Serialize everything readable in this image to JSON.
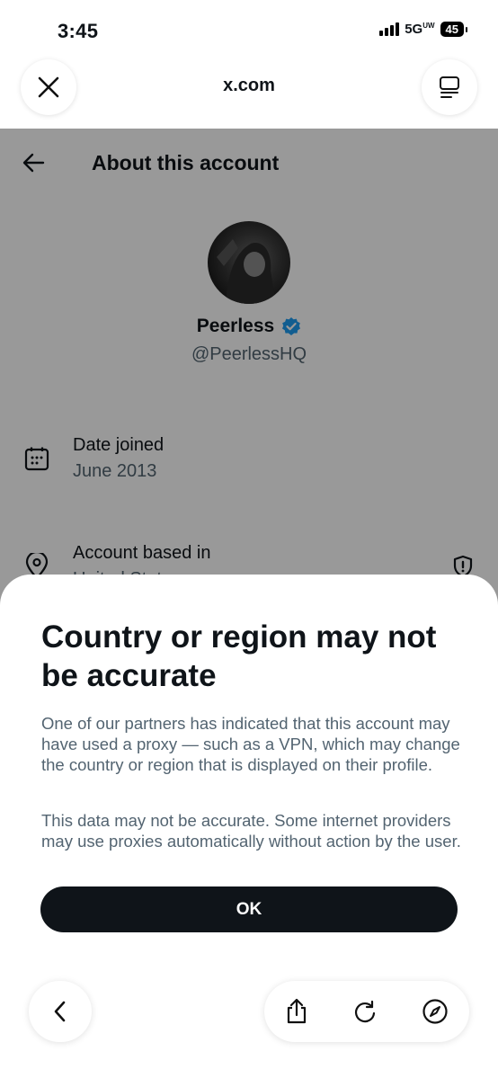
{
  "status_bar": {
    "time": "3:45",
    "network": "5G",
    "network_suffix": "UW",
    "battery": "45"
  },
  "browser": {
    "url": "x.com",
    "close_icon": "close-icon",
    "tabs_icon": "tabs-icon"
  },
  "page": {
    "header_title": "About this account",
    "profile": {
      "name": "Peerless",
      "handle": "@PeerlessHQ",
      "verified": true
    },
    "rows": [
      {
        "label": "Date joined",
        "value": "June 2013",
        "icon": "calendar-icon"
      },
      {
        "label": "Account based in",
        "value": "United States",
        "icon": "location-pin-icon"
      }
    ]
  },
  "sheet": {
    "title": "Country or region may not be accurate",
    "paragraph_1": "One of our partners has indicated that this account may have used a proxy — such as a VPN, which may change the country or region that is displayed on their profile.",
    "paragraph_2": "This data may not be accurate. Some internet providers may use proxies automatically without action by the user.",
    "ok_label": "OK"
  },
  "toolbar": {
    "back_icon": "chevron-left-icon",
    "share_icon": "share-icon",
    "reload_icon": "reload-icon",
    "compass_icon": "compass-icon"
  },
  "colors": {
    "accent_blue": "#1d9bf0",
    "text_primary": "#0f1419",
    "text_secondary": "#536471",
    "button_dark": "#0f1419"
  }
}
